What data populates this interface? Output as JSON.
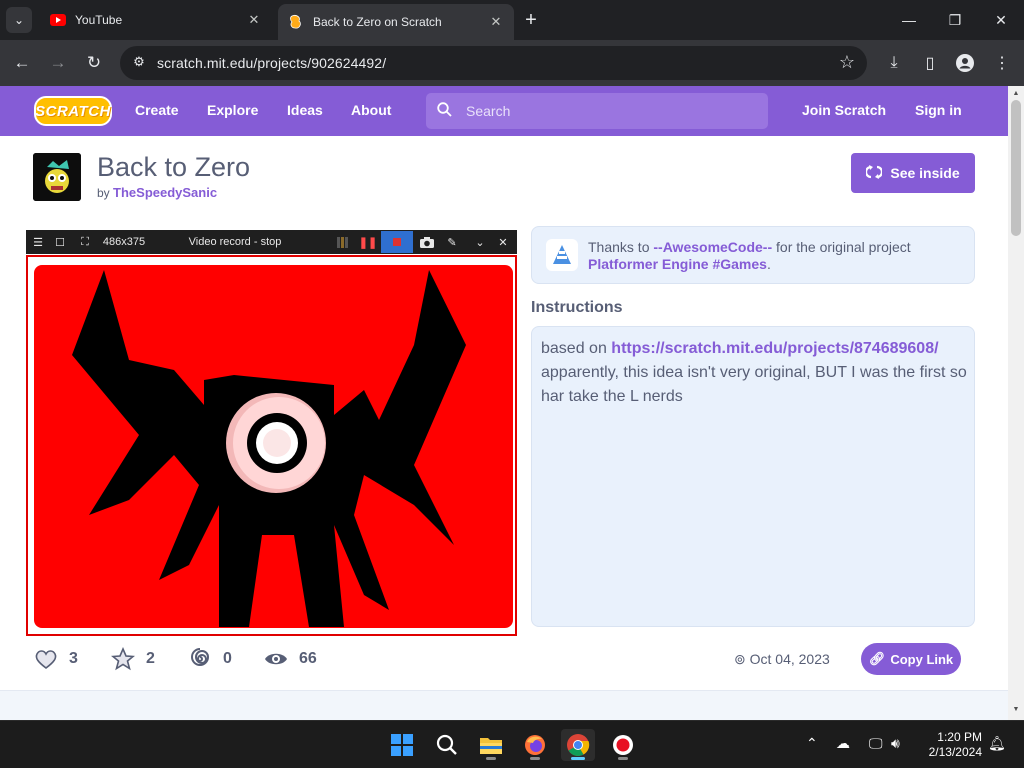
{
  "browser": {
    "tabs": [
      {
        "title": "YouTube",
        "active": false
      },
      {
        "title": "Back to Zero on Scratch",
        "active": true
      }
    ],
    "url": "scratch.mit.edu/projects/902624492/"
  },
  "scratch_nav": {
    "logo": "SCRATCH",
    "links": [
      "Create",
      "Explore",
      "Ideas",
      "About"
    ],
    "search_placeholder": "Search",
    "join": "Join Scratch",
    "signin": "Sign in"
  },
  "project": {
    "title": "Back to Zero",
    "by_label": "by",
    "author": "TheSpeedySanic",
    "see_inside": "See inside",
    "credit_prefix": "Thanks to",
    "credit_user": "--AwesomeCode--",
    "credit_middle": "for the original project",
    "credit_project": "Platformer Engine #Games",
    "credit_suffix": ".",
    "instructions_heading": "Instructions",
    "instr_prefix": "based on",
    "instr_link": "https://scratch.mit.edu/projects/874689608/",
    "instr_rest": "apparently, this idea isn't very original, BUT I was the first so har take the L nerds",
    "stats": {
      "loves": "3",
      "favorites": "2",
      "remixes": "0",
      "views": "66"
    },
    "date": "Oct 04, 2023",
    "copy_link": "Copy Link"
  },
  "recorder": {
    "size": "486x375",
    "status": "Video record - stop"
  },
  "taskbar": {
    "time": "1:20 PM",
    "date": "2/13/2024"
  },
  "colors": {
    "scratch_purple": "#855cd6",
    "stage_red": "#ff0000",
    "record_border": "#e00000"
  }
}
